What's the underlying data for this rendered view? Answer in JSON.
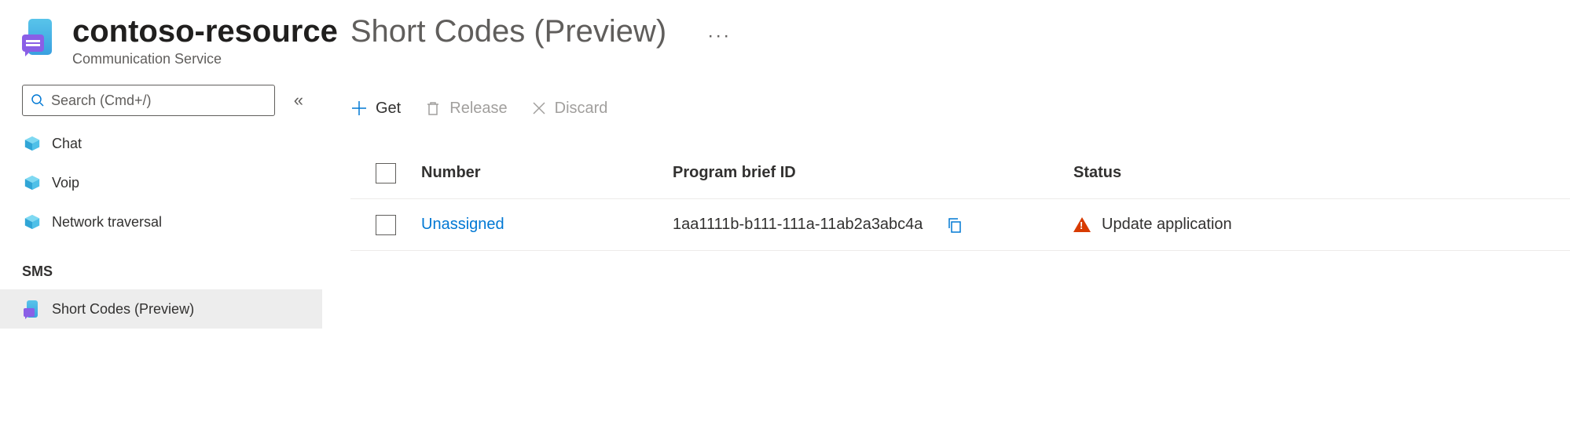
{
  "header": {
    "resource_name": "contoso-resource",
    "page_name": "Short Codes (Preview)",
    "subtitle": "Communication Service"
  },
  "search": {
    "placeholder": "Search (Cmd+/)"
  },
  "sidebar": {
    "items": [
      {
        "label": "Chat"
      },
      {
        "label": "Voip"
      },
      {
        "label": "Network traversal"
      }
    ],
    "section_label": "SMS",
    "active_label": "Short Codes (Preview)"
  },
  "toolbar": {
    "get_label": "Get",
    "release_label": "Release",
    "discard_label": "Discard"
  },
  "table": {
    "columns": {
      "number": "Number",
      "pbid": "Program brief ID",
      "status": "Status"
    },
    "rows": [
      {
        "number": "Unassigned",
        "pbid": "1aa1111b-b111-111a-11ab2a3abc4a",
        "status": "Update application"
      }
    ]
  }
}
